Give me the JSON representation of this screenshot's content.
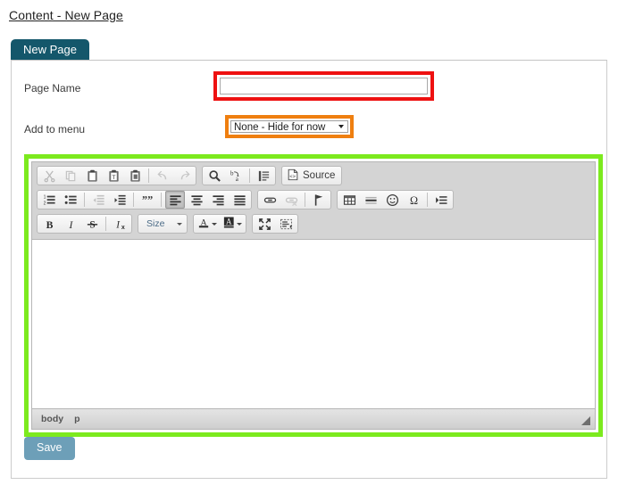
{
  "page": {
    "title": "Content - New Page"
  },
  "tabs": [
    {
      "label": "New Page",
      "active": true
    }
  ],
  "form": {
    "page_name": {
      "label": "Page Name",
      "value": "",
      "placeholder": "",
      "highlight_color": "#ee1111"
    },
    "add_to_menu": {
      "label": "Add to menu",
      "selected": "None - Hide for now",
      "options": [
        "None - Hide for now"
      ],
      "highlight_color": "#ef7f10"
    }
  },
  "editor": {
    "highlight_color": "#7cea1e",
    "content": "",
    "toolbar_rows": [
      {
        "groups": [
          {
            "name": "clipboard-undo",
            "buttons": [
              {
                "name": "cut-icon",
                "label": "Cut",
                "disabled": true
              },
              {
                "name": "copy-icon",
                "label": "Copy",
                "disabled": true
              },
              {
                "name": "paste-icon",
                "label": "Paste",
                "disabled": false
              },
              {
                "name": "paste-text-icon",
                "label": "Paste as plain text",
                "disabled": false
              },
              {
                "name": "paste-word-icon",
                "label": "Paste from Word",
                "disabled": false
              },
              {
                "name": "undo-icon",
                "label": "Undo",
                "disabled": true
              },
              {
                "name": "redo-icon",
                "label": "Redo",
                "disabled": true
              }
            ]
          },
          {
            "name": "find-select",
            "buttons": [
              {
                "name": "find-icon",
                "label": "Find",
                "disabled": false
              },
              {
                "name": "replace-icon",
                "label": "Replace",
                "disabled": false
              },
              {
                "name": "select-all-icon",
                "label": "Select All",
                "disabled": false
              }
            ]
          },
          {
            "name": "source",
            "buttons": [
              {
                "name": "source-icon",
                "label": "Source",
                "disabled": false
              }
            ]
          }
        ]
      },
      {
        "groups": [
          {
            "name": "paragraph",
            "buttons": [
              {
                "name": "numbered-list-icon",
                "label": "Insert/Remove Numbered List",
                "disabled": false
              },
              {
                "name": "bulleted-list-icon",
                "label": "Insert/Remove Bulleted List",
                "disabled": false
              },
              {
                "name": "decrease-indent-icon",
                "label": "Decrease Indent",
                "disabled": true
              },
              {
                "name": "increase-indent-icon",
                "label": "Increase Indent",
                "disabled": false
              },
              {
                "name": "blockquote-icon",
                "label": "Block Quote",
                "disabled": false
              },
              {
                "name": "align-left-icon",
                "label": "Align Left",
                "disabled": false,
                "active": true
              },
              {
                "name": "align-center-icon",
                "label": "Center",
                "disabled": false
              },
              {
                "name": "align-right-icon",
                "label": "Align Right",
                "disabled": false
              },
              {
                "name": "justify-icon",
                "label": "Justify",
                "disabled": false
              }
            ]
          },
          {
            "name": "links",
            "buttons": [
              {
                "name": "link-icon",
                "label": "Link",
                "disabled": false
              },
              {
                "name": "unlink-icon",
                "label": "Unlink",
                "disabled": true
              },
              {
                "name": "anchor-icon",
                "label": "Anchor",
                "disabled": false
              }
            ]
          },
          {
            "name": "insert",
            "buttons": [
              {
                "name": "table-icon",
                "label": "Table",
                "disabled": false
              },
              {
                "name": "horizontal-rule-icon",
                "label": "Horizontal Line",
                "disabled": false
              },
              {
                "name": "smiley-icon",
                "label": "Smiley",
                "disabled": false
              },
              {
                "name": "special-char-icon",
                "label": "Insert Special Character",
                "disabled": false
              },
              {
                "name": "page-break-icon",
                "label": "Page Break for Printing",
                "disabled": false
              }
            ]
          }
        ]
      },
      {
        "groups": [
          {
            "name": "basic-styles",
            "buttons": [
              {
                "name": "bold-icon",
                "label": "Bold",
                "disabled": false
              },
              {
                "name": "italic-icon",
                "label": "Italic",
                "disabled": false
              },
              {
                "name": "strikethrough-icon",
                "label": "Strike Through",
                "disabled": false
              },
              {
                "name": "remove-format-icon",
                "label": "Remove Format",
                "disabled": false
              }
            ]
          },
          {
            "name": "font-size",
            "combo_label": "Size"
          },
          {
            "name": "colors",
            "buttons": [
              {
                "name": "text-color-icon",
                "label": "Text Color",
                "disabled": false
              },
              {
                "name": "background-color-icon",
                "label": "Background Color",
                "disabled": false
              }
            ]
          },
          {
            "name": "tools",
            "buttons": [
              {
                "name": "maximize-icon",
                "label": "Maximize",
                "disabled": false
              },
              {
                "name": "show-blocks-icon",
                "label": "Show Blocks",
                "disabled": false
              }
            ]
          }
        ]
      }
    ],
    "status_path": [
      "body",
      "p"
    ]
  },
  "actions": {
    "save_label": "Save",
    "save_color": "#6d9fb8"
  }
}
